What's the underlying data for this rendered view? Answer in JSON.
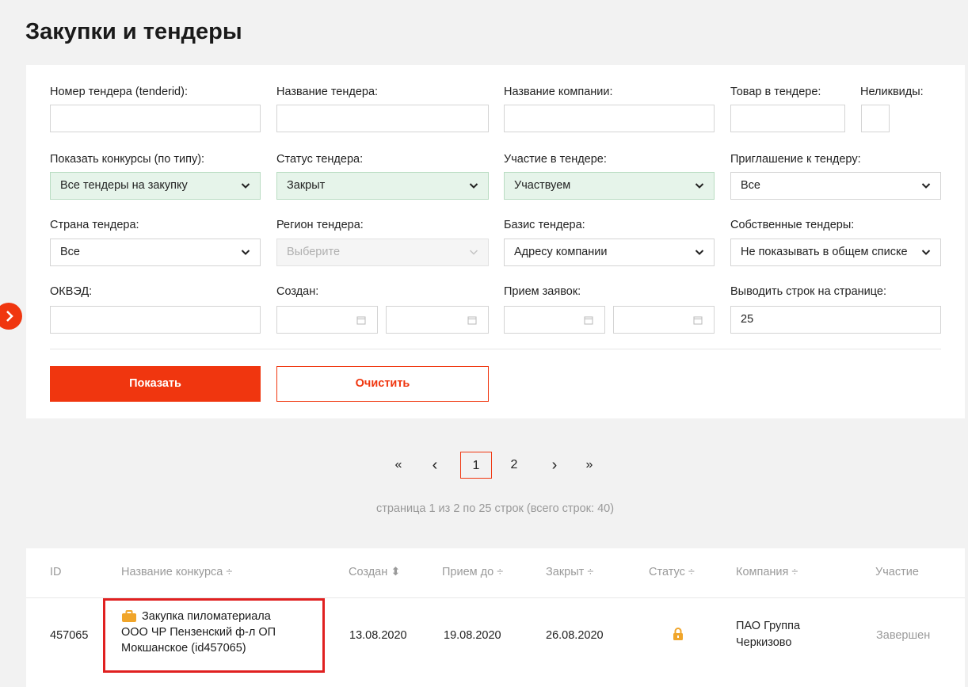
{
  "page": {
    "title": "Закупки и тендеры"
  },
  "colors": {
    "accent": "#f0360f",
    "green_select_bg": "#e6f4ea",
    "highlight_border": "#e02020",
    "lock_icon": "#f0a52a"
  },
  "filters": {
    "tender_number": {
      "label": "Номер тендера (tenderid):",
      "value": ""
    },
    "tender_name": {
      "label": "Название тендера:",
      "value": ""
    },
    "company_name": {
      "label": "Название компании:",
      "value": ""
    },
    "product": {
      "label": "Товар в тендере:",
      "value": ""
    },
    "illiquid": {
      "label": "Неликвиды:",
      "value": ""
    },
    "contest_type": {
      "label": "Показать конкурсы (по типу):",
      "value": "Все тендеры на закупку"
    },
    "tender_status": {
      "label": "Статус тендера:",
      "value": "Закрыт"
    },
    "participation": {
      "label": "Участие в тендере:",
      "value": "Участвуем"
    },
    "invitation": {
      "label": "Приглашение к тендеру:",
      "value": "Все"
    },
    "country": {
      "label": "Страна тендера:",
      "value": "Все"
    },
    "region": {
      "label": "Регион тендера:",
      "value": "Выберите"
    },
    "basis": {
      "label": "Базис тендера:",
      "value": "Адресу компании"
    },
    "own_tenders": {
      "label": "Собственные тендеры:",
      "value": "Не показывать в общем списке"
    },
    "okved": {
      "label": "ОКВЭД:",
      "value": ""
    },
    "created": {
      "label": "Создан:"
    },
    "applications": {
      "label": "Прием заявок:"
    },
    "rows_per_page": {
      "label": "Выводить строк на странице:",
      "value": "25"
    }
  },
  "buttons": {
    "show": "Показать",
    "clear": "Очистить"
  },
  "pagination": {
    "first": "«",
    "prev": "‹",
    "pages": [
      "1",
      "2"
    ],
    "current": "1",
    "next": "›",
    "last": "»",
    "info": "страница 1 из 2 по 25 строк (всего строк: 40)"
  },
  "table": {
    "headers": {
      "id": "ID",
      "name": "Название конкурса ÷",
      "created": "Создан ⬍",
      "accept_until": "Прием до ÷",
      "closed": "Закрыт ÷",
      "status": "Статус ÷",
      "company": "Компания ÷",
      "participation": "Участие"
    },
    "rows": [
      {
        "id": "457065",
        "name_line1": "Закупка пиломатериала",
        "name_line2": "ООО ЧР Пензенский ф-л ОП",
        "name_line3": "Мокшанское (id457065)",
        "created": "13.08.2020",
        "accept_until": "19.08.2020",
        "closed": "26.08.2020",
        "status_icon": "lock-icon",
        "company_line1": "ПАО Группа",
        "company_line2": "Черкизово",
        "participation": "Завершен"
      }
    ]
  }
}
